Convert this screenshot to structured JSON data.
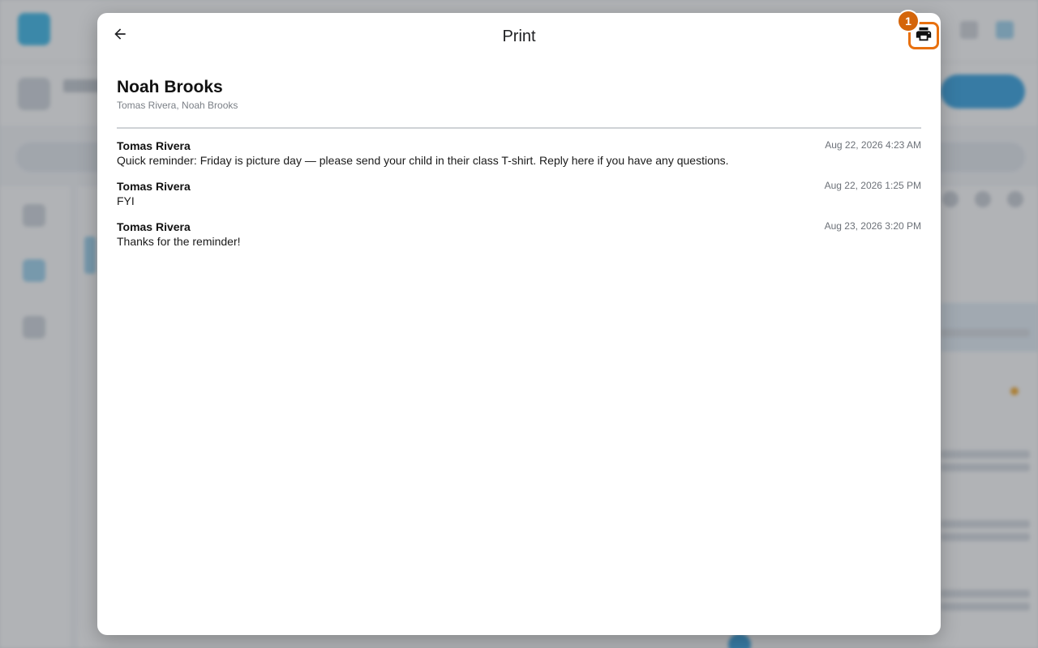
{
  "background": {
    "overlay_color": "#5a5e64",
    "accent_color": "#2e9fe0",
    "logo_color": "#35b6e8"
  },
  "modal": {
    "title": "Print",
    "back_icon": "arrow-left-icon",
    "print_icon": "printer-icon",
    "highlight_color": "#e8700e",
    "step_badge": "1"
  },
  "conversation": {
    "title": "Noah Brooks",
    "participants": "Tomas Rivera, Noah Brooks",
    "messages": [
      {
        "sender": "Tomas Rivera",
        "timestamp": "Aug 22, 2026 4:23 AM",
        "text": "Quick reminder: Friday is picture day — please send your child in their class T-shirt. Reply here if you have any questions."
      },
      {
        "sender": "Tomas Rivera",
        "timestamp": "Aug 22, 2026 1:25 PM",
        "text": "FYI"
      },
      {
        "sender": "Tomas Rivera",
        "timestamp": "Aug 23, 2026 3:20 PM",
        "text": "Thanks for the reminder!"
      }
    ]
  }
}
